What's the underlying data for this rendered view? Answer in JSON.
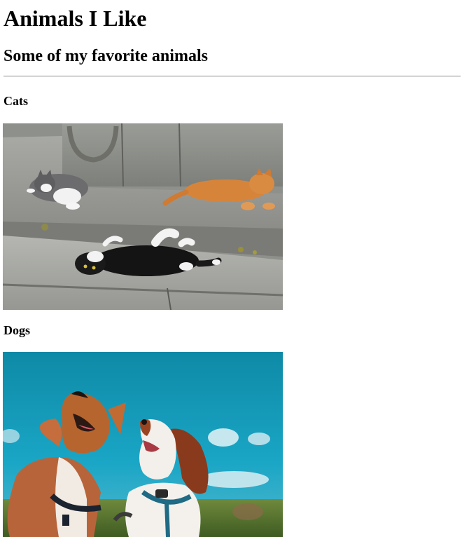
{
  "page": {
    "title": "Animals I Like",
    "subtitle": "Some of my favorite animals"
  },
  "sections": [
    {
      "heading": "Cats",
      "image_subject": "cats lying on stone steps"
    },
    {
      "heading": "Dogs",
      "image_subject": "two dogs looking up under a blue sky"
    }
  ],
  "colors": {
    "text": "#000000",
    "divider": "#8a8a8a",
    "background": "#ffffff",
    "sky": "#1a9ab8"
  }
}
